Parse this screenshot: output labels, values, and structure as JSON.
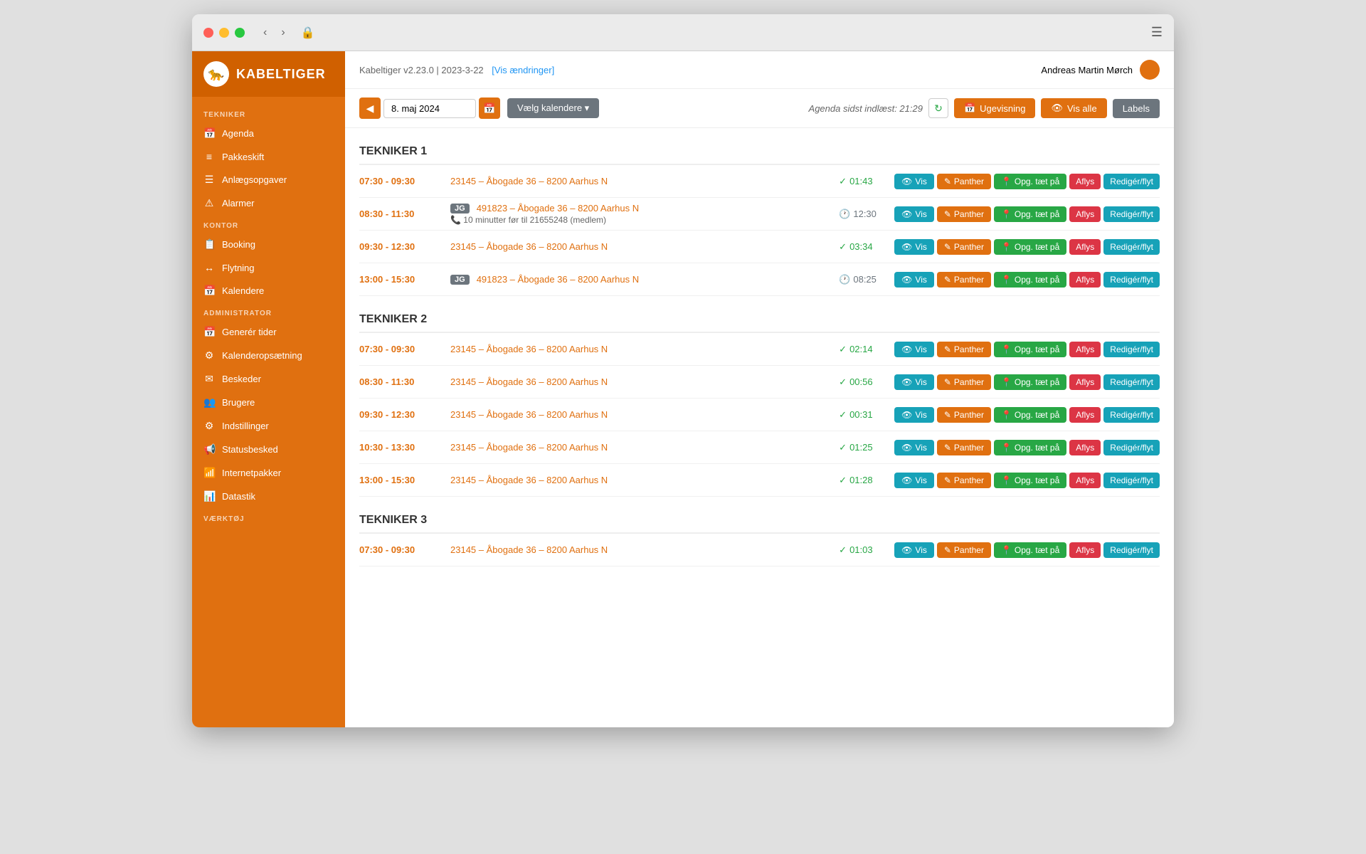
{
  "app": {
    "title": "KABELTIGER"
  },
  "titlebar": {
    "back": "‹",
    "forward": "›",
    "lock": "🔒",
    "menu": "☰"
  },
  "header": {
    "version": "Kabeltiger v2.23.0 | 2023-3-22",
    "changelog_link": "[Vis ændringer]",
    "agenda_status": "Agenda sidst indlæst: 21:29",
    "user_name": "Andreas Martin Mørch"
  },
  "toolbar": {
    "date": "8. maj 2024",
    "calendar_btn": "Vælg kalendere ▾",
    "ugevisning_btn": "Ugevisning",
    "vis_alle_btn": "Vis alle",
    "labels_btn": "Labels"
  },
  "sidebar": {
    "sections": [
      {
        "label": "TEKNIKER",
        "items": [
          {
            "icon": "📅",
            "label": "Agenda"
          },
          {
            "icon": "≡",
            "label": "Pakkeskift"
          },
          {
            "icon": "☰",
            "label": "Anlægsopgaver"
          },
          {
            "icon": "⚠",
            "label": "Alarmer"
          }
        ]
      },
      {
        "label": "KONTOR",
        "items": [
          {
            "icon": "📋",
            "label": "Booking"
          },
          {
            "icon": "↔",
            "label": "Flytning"
          },
          {
            "icon": "📅",
            "label": "Kalendere"
          }
        ]
      },
      {
        "label": "ADMINISTRATOR",
        "items": [
          {
            "icon": "📅",
            "label": "Generér tider"
          },
          {
            "icon": "⚙",
            "label": "Kalenderopsætning"
          },
          {
            "icon": "✉",
            "label": "Beskeder"
          },
          {
            "icon": "👥",
            "label": "Brugere"
          },
          {
            "icon": "⚙",
            "label": "Indstillinger"
          },
          {
            "icon": "📢",
            "label": "Statusbesked"
          },
          {
            "icon": "📶",
            "label": "Internetpakker"
          },
          {
            "icon": "📊",
            "label": "Datastik"
          }
        ]
      },
      {
        "label": "VÆRKTØJ",
        "items": []
      }
    ]
  },
  "technicians": [
    {
      "name": "TEKNIKER 1",
      "appointments": [
        {
          "time": "07:30 - 09:30",
          "title": "23145 – Åbogade 36 – 8200 Aarhus N",
          "badge": "",
          "status_icon": "✓",
          "status_time": "01:43",
          "status_type": "green",
          "subtitle": ""
        },
        {
          "time": "08:30 - 11:30",
          "title": "491823 – Åbogade 36 – 8200 Aarhus N",
          "badge": "JG",
          "status_icon": "🕐",
          "status_time": "12:30",
          "status_type": "gray",
          "subtitle": "10 minutter før til 21655248 (medlem)"
        },
        {
          "time": "09:30 - 12:30",
          "title": "23145 – Åbogade 36 – 8200 Aarhus N",
          "badge": "",
          "status_icon": "✓",
          "status_time": "03:34",
          "status_type": "green",
          "subtitle": ""
        },
        {
          "time": "13:00 - 15:30",
          "title": "491823 – Åbogade 36 – 8200 Aarhus N",
          "badge": "JG",
          "status_icon": "🕐",
          "status_time": "08:25",
          "status_type": "gray",
          "subtitle": ""
        }
      ]
    },
    {
      "name": "TEKNIKER 2",
      "appointments": [
        {
          "time": "07:30 - 09:30",
          "title": "23145 – Åbogade 36 – 8200 Aarhus N",
          "badge": "",
          "status_icon": "✓",
          "status_time": "02:14",
          "status_type": "green",
          "subtitle": ""
        },
        {
          "time": "08:30 - 11:30",
          "title": "23145 – Åbogade 36 – 8200 Aarhus N",
          "badge": "",
          "status_icon": "✓",
          "status_time": "00:56",
          "status_type": "green",
          "subtitle": ""
        },
        {
          "time": "09:30 - 12:30",
          "title": "23145 – Åbogade 36 – 8200 Aarhus N",
          "badge": "",
          "status_icon": "✓",
          "status_time": "00:31",
          "status_type": "green",
          "subtitle": ""
        },
        {
          "time": "10:30 - 13:30",
          "title": "23145 – Åbogade 36 – 8200 Aarhus N",
          "badge": "",
          "status_icon": "✓",
          "status_time": "01:25",
          "status_type": "green",
          "subtitle": ""
        },
        {
          "time": "13:00 - 15:30",
          "title": "23145 – Åbogade 36 – 8200 Aarhus N",
          "badge": "",
          "status_icon": "✓",
          "status_time": "01:28",
          "status_type": "green",
          "subtitle": ""
        }
      ]
    },
    {
      "name": "TEKNIKER 3",
      "appointments": [
        {
          "time": "07:30 - 09:30",
          "title": "23145 – Åbogade 36 – 8200 Aarhus N",
          "badge": "",
          "status_icon": "✓",
          "status_time": "01:03",
          "status_type": "green",
          "subtitle": ""
        }
      ]
    }
  ],
  "buttons": {
    "vis": "Vis",
    "panther": "Panther",
    "opg": "Opg. tæt på",
    "aflys": "Aflys",
    "rediger": "Redigér/flyt"
  }
}
